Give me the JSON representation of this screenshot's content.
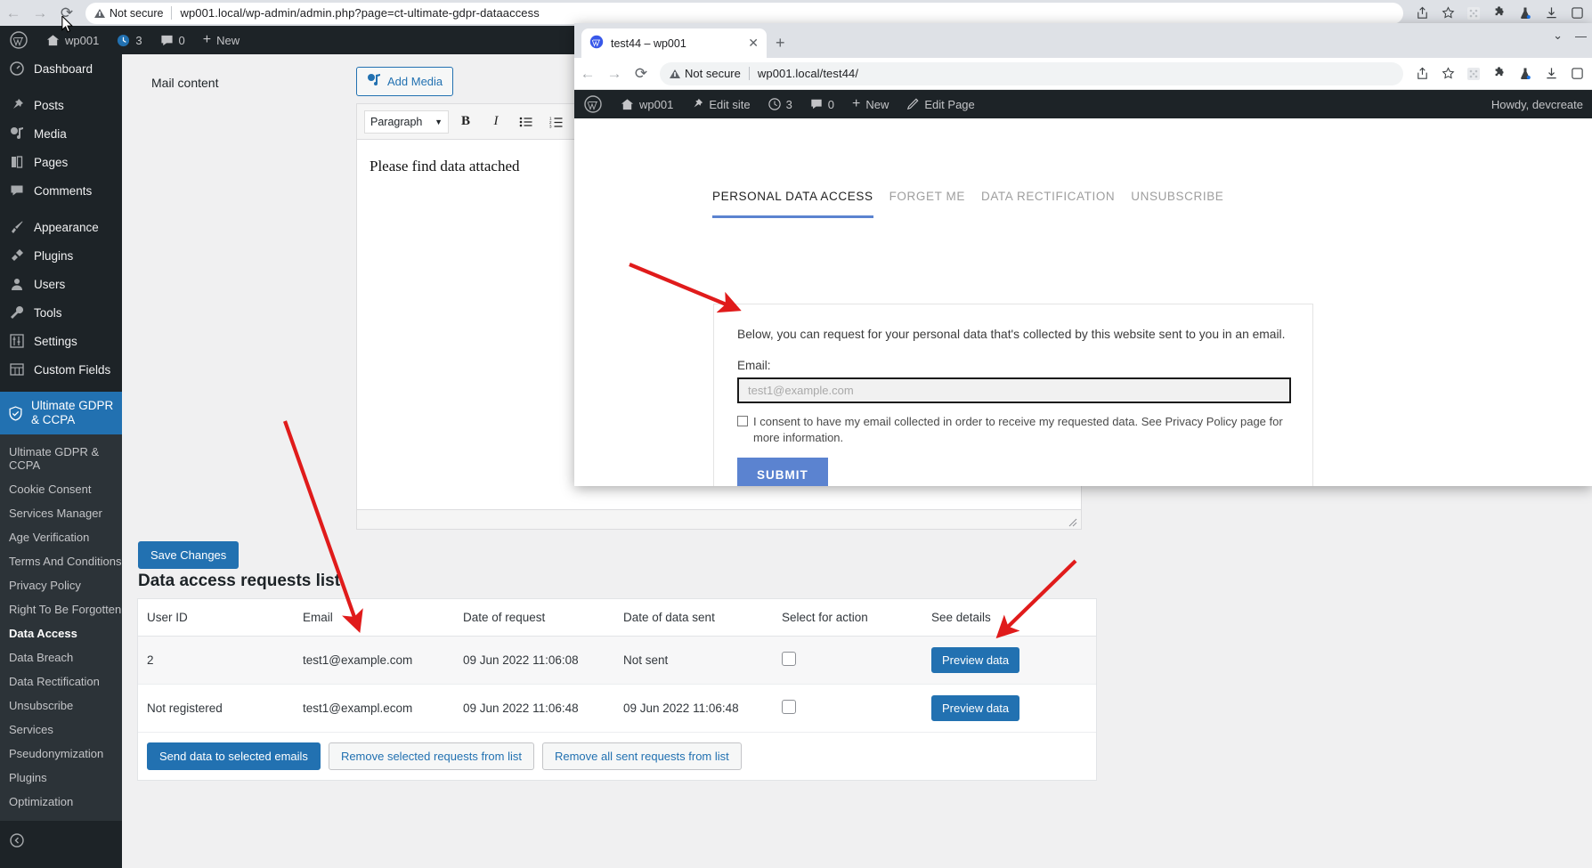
{
  "outer_browser": {
    "nav": {
      "back": "←",
      "forward": "→",
      "reload": "⟳"
    },
    "security_label": "Not secure",
    "url": "wp001.local/wp-admin/admin.php?page=ct-ultimate-gdpr-dataaccess",
    "toolbar_icons": [
      "share-icon",
      "bookmark-star-icon",
      "puzzle-grid-icon",
      "extensions-puzzle-icon",
      "lab-flask-icon",
      "download-icon",
      "profile-icon"
    ]
  },
  "adminbar": {
    "logo": "W",
    "site": "wp001",
    "updates": "3",
    "comments": "0",
    "new": "New"
  },
  "sidebar": {
    "top_items": [
      {
        "label": "Dashboard",
        "icon": "dashboard-icon"
      },
      {
        "label": "Posts",
        "icon": "pin-icon"
      },
      {
        "label": "Media",
        "icon": "media-icon"
      },
      {
        "label": "Pages",
        "icon": "pages-icon"
      },
      {
        "label": "Comments",
        "icon": "comment-icon"
      },
      {
        "label": "Appearance",
        "icon": "brush-icon"
      },
      {
        "label": "Plugins",
        "icon": "plug-icon"
      },
      {
        "label": "Users",
        "icon": "user-icon"
      },
      {
        "label": "Tools",
        "icon": "wrench-icon"
      },
      {
        "label": "Settings",
        "icon": "sliders-icon"
      },
      {
        "label": "Custom Fields",
        "icon": "table-icon"
      }
    ],
    "current_top": {
      "label": "Ultimate GDPR & CCPA",
      "icon": "shield-icon"
    },
    "submenu": [
      "Ultimate GDPR & CCPA",
      "Cookie Consent",
      "Services Manager",
      "Age Verification",
      "Terms And Conditions",
      "Privacy Policy",
      "Right To Be Forgotten",
      "Data Access",
      "Data Breach",
      "Data Rectification",
      "Unsubscribe",
      "Services",
      "Pseudonymization",
      "Plugins",
      "Optimization"
    ],
    "submenu_current": "Data Access"
  },
  "editor": {
    "field_label": "Mail content",
    "add_media_label": "Add Media",
    "format_select": "Paragraph",
    "toolbar_buttons": [
      "bold-icon",
      "italic-icon",
      "bulleted-list-icon",
      "numbered-list-icon",
      "blockquote-icon"
    ],
    "content": "Please find data attached"
  },
  "save_button_label": "Save Changes",
  "list": {
    "title": "Data access requests list",
    "columns": [
      "User ID",
      "Email",
      "Date of request",
      "Date of data sent",
      "Select for action",
      "See details"
    ],
    "rows": [
      {
        "user_id": "2",
        "email": "test1@example.com",
        "date_of_request": "09 Jun 2022 11:06:08",
        "date_of_data_sent": "Not sent",
        "selected": false,
        "action_label": "Preview data"
      },
      {
        "user_id": "Not registered",
        "email": "test1@exampl.ecom",
        "date_of_request": "09 Jun 2022 11:06:48",
        "date_of_data_sent": "09 Jun 2022 11:06:48",
        "selected": false,
        "action_label": "Preview data"
      }
    ],
    "actions": [
      "Send data to selected emails",
      "Remove selected requests from list",
      "Remove all sent requests from list"
    ]
  },
  "inner_browser": {
    "tab_title": "test44 – wp001",
    "tab_close": "✕",
    "new_tab": "+",
    "window_controls": {
      "list": "⌄",
      "minimize": "—"
    },
    "security_label": "Not secure",
    "url": "wp001.local/test44/",
    "adminbar": {
      "site": "wp001",
      "edit_site": "Edit site",
      "updates": "3",
      "comments": "0",
      "new": "New",
      "edit_page": "Edit Page",
      "howdy": "Howdy, devcreate"
    },
    "frontend": {
      "tabs": [
        {
          "label": "PERSONAL DATA ACCESS",
          "active": true
        },
        {
          "label": "FORGET ME",
          "active": false
        },
        {
          "label": "DATA RECTIFICATION",
          "active": false
        },
        {
          "label": "UNSUBSCRIBE",
          "active": false
        }
      ],
      "intro": "Below, you can request for your personal data that's collected by this website sent to you in an email.",
      "email_label": "Email:",
      "email_placeholder": "test1@example.com",
      "email_value": "",
      "consent_text": "I consent to have my email collected in order to receive my requested data. See Privacy Policy page for more information.",
      "submit_label": "SUBMIT"
    }
  },
  "colors": {
    "wp_blue": "#2271b1",
    "wp_dark": "#1d2327",
    "submit_blue": "#5b83d0",
    "annotation_red": "#e01b1b"
  }
}
